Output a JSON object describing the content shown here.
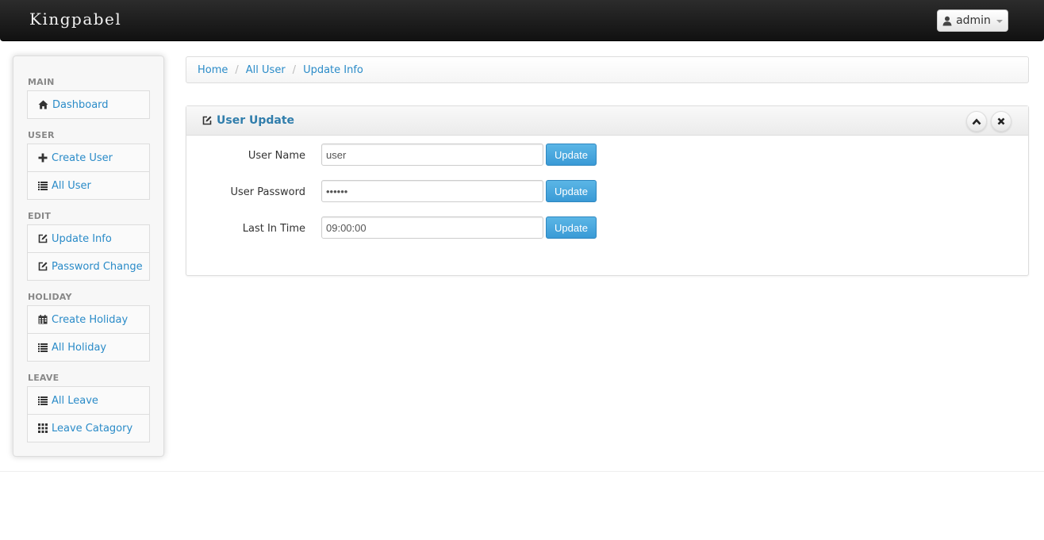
{
  "navbar": {
    "brand": "Kingpabel",
    "user_label": "admin"
  },
  "sidebar": {
    "sections": [
      {
        "header": "MAIN",
        "items": [
          {
            "label": "Dashboard",
            "icon": "home-icon"
          }
        ]
      },
      {
        "header": "USER",
        "items": [
          {
            "label": "Create User",
            "icon": "plus-icon"
          },
          {
            "label": "All User",
            "icon": "list-icon"
          }
        ]
      },
      {
        "header": "EDIT",
        "items": [
          {
            "label": "Update Info",
            "icon": "edit-icon"
          },
          {
            "label": "Password Change",
            "icon": "edit-icon"
          }
        ]
      },
      {
        "header": "HOLIDAY",
        "items": [
          {
            "label": "Create Holiday",
            "icon": "calendar-icon"
          },
          {
            "label": "All Holiday",
            "icon": "list-icon"
          }
        ]
      },
      {
        "header": "LEAVE",
        "items": [
          {
            "label": "All Leave",
            "icon": "list-icon"
          },
          {
            "label": "Leave Catagory",
            "icon": "grid-icon"
          }
        ]
      }
    ]
  },
  "breadcrumb": {
    "items": [
      "Home",
      "All User",
      "Update Info"
    ],
    "separator": "/"
  },
  "panel": {
    "title": "User Update",
    "rows": [
      {
        "label": "User Name",
        "value": "user",
        "button": "Update"
      },
      {
        "label": "User Password",
        "value": "••••••",
        "button": "Update"
      },
      {
        "label": "Last In Time",
        "value": "09:00:00",
        "button": "Update"
      }
    ]
  },
  "colors": {
    "link": "#2a8bc8",
    "title": "#317eac",
    "button": "#3a9ad6",
    "navbar": "#1a1a1a"
  }
}
